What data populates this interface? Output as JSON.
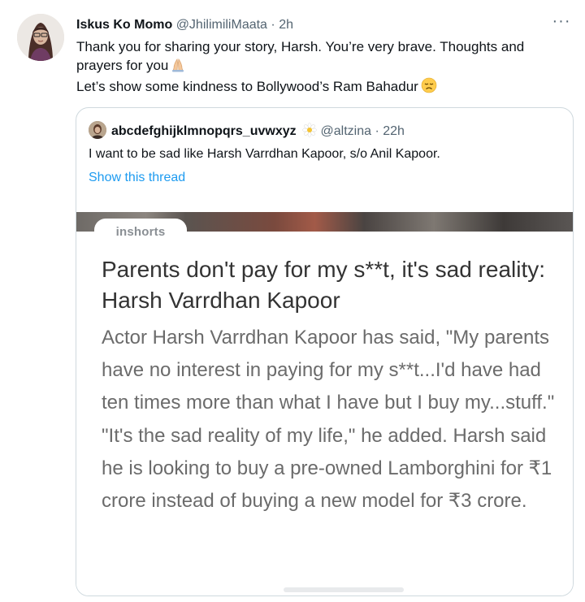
{
  "tweet": {
    "author_name": "Iskus Ko Momo",
    "author_handle": "@JhilimiliMaata",
    "separator": "·",
    "time": "2h",
    "more": "···",
    "line1": "Thank you for sharing your story, Harsh. You’re very brave. Thoughts and prayers for you",
    "line2": "Let’s show some kindness to Bollywood’s Ram Bahadur"
  },
  "quote": {
    "author_name": "abcdefghijklmnopqrs_uvwxyz",
    "author_handle": "@altzina",
    "separator": "·",
    "time": "22h",
    "text": "I want to be sad like Harsh Varrdhan Kapoor, s/o Anil Kapoor.",
    "show_thread": "Show this thread"
  },
  "card": {
    "source": "inshorts",
    "headline": "Parents don't pay for my s**t, it's sad reality: Harsh Varrdhan Kapoor",
    "body": "Actor Harsh Varrdhan Kapoor has said, \"My parents have no interest in paying for my s**t...I'd have had ten times more than what I have but I buy my...stuff.\" \"It's the sad reality of my life,\" he added. Harsh said he is looking to buy a pre-owned Lamborghini for ₹1 crore instead of buying a new model for ₹3 crore."
  },
  "icons": {
    "prayer": "folded-hands-emoji",
    "sad": "disappointed-face-emoji",
    "flower": "daisy-emoji",
    "more": "ellipsis-icon"
  },
  "colors": {
    "link": "#1d9bf0",
    "muted": "#536471",
    "border": "#cfd9de"
  }
}
